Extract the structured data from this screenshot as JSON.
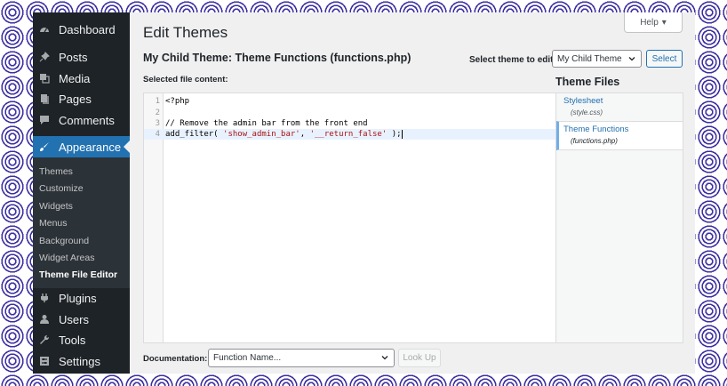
{
  "sidebar": {
    "items": [
      {
        "label": "Dashboard",
        "icon": "dashboard-icon"
      },
      {
        "label": "Posts",
        "icon": "pin-icon"
      },
      {
        "label": "Media",
        "icon": "media-icon"
      },
      {
        "label": "Pages",
        "icon": "page-icon"
      },
      {
        "label": "Comments",
        "icon": "comment-icon"
      },
      {
        "label": "Appearance",
        "icon": "brush-icon",
        "active": true
      },
      {
        "label": "Plugins",
        "icon": "plug-icon"
      },
      {
        "label": "Users",
        "icon": "user-icon"
      },
      {
        "label": "Tools",
        "icon": "wrench-icon"
      },
      {
        "label": "Settings",
        "icon": "settings-icon"
      }
    ],
    "submenu": [
      "Themes",
      "Customize",
      "Widgets",
      "Menus",
      "Background",
      "Widget Areas",
      "Theme File Editor"
    ]
  },
  "header": {
    "help_label": "Help",
    "page_title": "Edit Themes"
  },
  "editor": {
    "file_title": "My Child Theme: Theme Functions (functions.php)",
    "select_theme_label": "Select theme to edit:",
    "selected_theme": "My Child Theme",
    "select_button": "Select",
    "content_label": "Selected file content:",
    "lines": [
      {
        "num": "1",
        "text": "<?php"
      },
      {
        "num": "2",
        "text": ""
      },
      {
        "num": "3",
        "comment": "// Remove the admin bar from the front end"
      },
      {
        "num": "4",
        "pre": "add_filter( ",
        "str1": "'show_admin_bar'",
        "mid": ", ",
        "str2": "'__return_false'",
        "post": " );"
      }
    ]
  },
  "files": {
    "title": "Theme Files",
    "items": [
      {
        "name": "Stylesheet",
        "desc": "(style.css)"
      },
      {
        "name": "Theme Functions",
        "desc": "(functions.php)"
      }
    ]
  },
  "documentation": {
    "label": "Documentation:",
    "select_value": "Function Name...",
    "lookup_button": "Look Up"
  },
  "colors": {
    "sidebar_bg": "#1d2327",
    "active_bg": "#2271b1",
    "link": "#2271b1",
    "background_pattern": "#3b2fa0"
  }
}
